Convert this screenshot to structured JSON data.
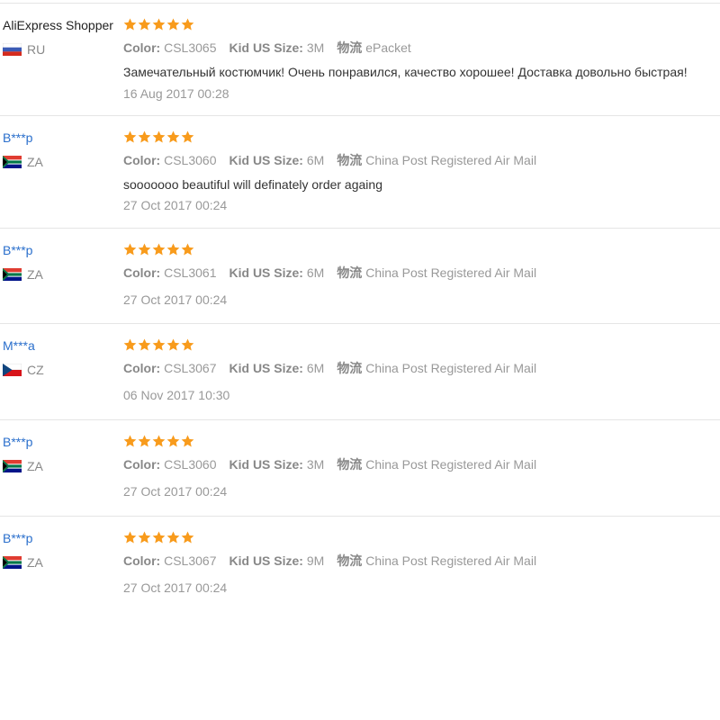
{
  "labels": {
    "color": "Color:",
    "kid_us_size": "Kid US Size:",
    "logistics": "物流"
  },
  "colors": {
    "star": "#f89b1c",
    "username_link": "#2a6fcc"
  },
  "reviews": [
    {
      "user": "AliExpress Shopper",
      "country": "RU",
      "flag": "russia-flag-icon",
      "rating": 5,
      "color": "CSL3065",
      "size": "3M",
      "shipping": "ePacket",
      "text": "Замечательный костюмчик! Очень понравился, качество хорошее! Доставка довольно быстрая!",
      "date": "16 Aug 2017 00:28"
    },
    {
      "user": "B***p",
      "country": "ZA",
      "flag": "south-africa-flag-icon",
      "rating": 5,
      "color": "CSL3060",
      "size": "6M",
      "shipping": "China Post Registered Air Mail",
      "text": "sooooooo beautiful will definately order againg",
      "date": "27 Oct 2017 00:24"
    },
    {
      "user": "B***p",
      "country": "ZA",
      "flag": "south-africa-flag-icon",
      "rating": 5,
      "color": "CSL3061",
      "size": "6M",
      "shipping": "China Post Registered Air Mail",
      "text": "",
      "date": "27 Oct 2017 00:24"
    },
    {
      "user": "M***a",
      "country": "CZ",
      "flag": "czech-flag-icon",
      "rating": 5,
      "color": "CSL3067",
      "size": "6M",
      "shipping": "China Post Registered Air Mail",
      "text": "",
      "date": "06 Nov 2017 10:30"
    },
    {
      "user": "B***p",
      "country": "ZA",
      "flag": "south-africa-flag-icon",
      "rating": 5,
      "color": "CSL3060",
      "size": "3M",
      "shipping": "China Post Registered Air Mail",
      "text": "",
      "date": "27 Oct 2017 00:24"
    },
    {
      "user": "B***p",
      "country": "ZA",
      "flag": "south-africa-flag-icon",
      "rating": 5,
      "color": "CSL3067",
      "size": "9M",
      "shipping": "China Post Registered Air Mail",
      "text": "",
      "date": "27 Oct 2017 00:24"
    }
  ]
}
